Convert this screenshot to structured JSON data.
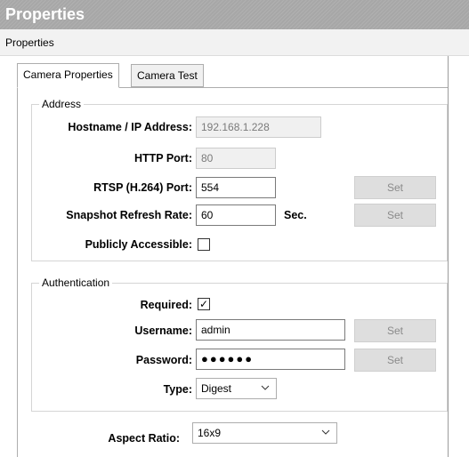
{
  "window": {
    "title": "Properties"
  },
  "section": {
    "label": "Properties"
  },
  "tabs": [
    {
      "label": "Camera Properties",
      "active": true
    },
    {
      "label": "Camera Test",
      "active": false
    }
  ],
  "address": {
    "legend": "Address",
    "hostname": {
      "label": "Hostname / IP Address:",
      "value": "192.168.1.228"
    },
    "http_port": {
      "label": "HTTP Port:",
      "value": "80"
    },
    "rtsp_port": {
      "label": "RTSP (H.264) Port:",
      "value": "554",
      "button": "Set"
    },
    "snapshot_rate": {
      "label": "Snapshot Refresh Rate:",
      "value": "60",
      "unit": "Sec.",
      "button": "Set"
    },
    "public": {
      "label": "Publicly Accessible:",
      "checked": false
    }
  },
  "authentication": {
    "legend": "Authentication",
    "required": {
      "label": "Required:",
      "checked": true,
      "check_glyph": "✓"
    },
    "username": {
      "label": "Username:",
      "value": "admin",
      "button": "Set"
    },
    "password": {
      "label": "Password:",
      "value": "●●●●●●",
      "button": "Set"
    },
    "type": {
      "label": "Type:",
      "value": "Digest"
    }
  },
  "aspect_ratio": {
    "label": "Aspect Ratio:",
    "value": "16x9"
  },
  "colors": {
    "titlebar": "#a7a7a7",
    "button_bg": "#dedede",
    "button_text": "#8a8a8a"
  }
}
